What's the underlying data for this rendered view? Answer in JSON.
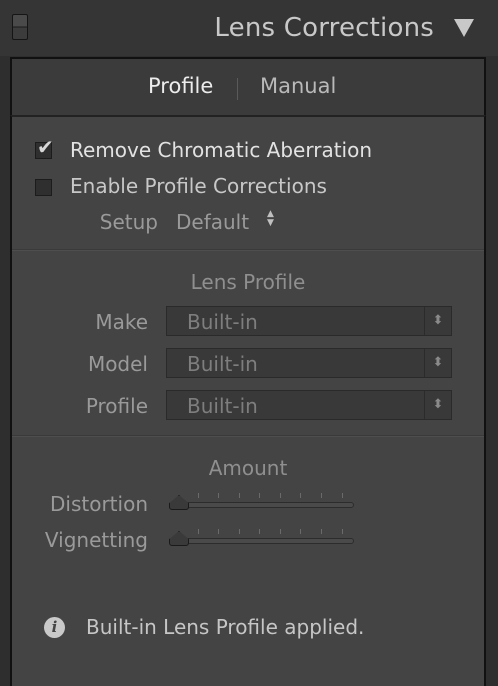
{
  "header": {
    "title": "Lens Corrections",
    "collapse_icon": "triangle-down-icon"
  },
  "tabs": [
    {
      "label": "Profile",
      "active": true
    },
    {
      "label": "Manual",
      "active": false
    }
  ],
  "checkboxes": {
    "chromatic": {
      "label": "Remove Chromatic Aberration",
      "checked": true
    },
    "profile": {
      "label": "Enable Profile Corrections",
      "checked": false
    }
  },
  "setup": {
    "label": "Setup",
    "value": "Default"
  },
  "lens_profile": {
    "title": "Lens Profile",
    "fields": [
      {
        "label": "Make",
        "value": "Built-in"
      },
      {
        "label": "Model",
        "value": "Built-in"
      },
      {
        "label": "Profile",
        "value": "Built-in"
      }
    ]
  },
  "amount": {
    "title": "Amount",
    "sliders": [
      {
        "label": "Distortion",
        "value": 0
      },
      {
        "label": "Vignetting",
        "value": 0
      }
    ]
  },
  "info": {
    "icon": "info-icon",
    "text": "Built-in Lens Profile applied."
  },
  "colors": {
    "panel_bg": "#444444",
    "header_bg": "#353535",
    "text_active": "#ececec",
    "text_disabled": "#8f8f8f"
  }
}
